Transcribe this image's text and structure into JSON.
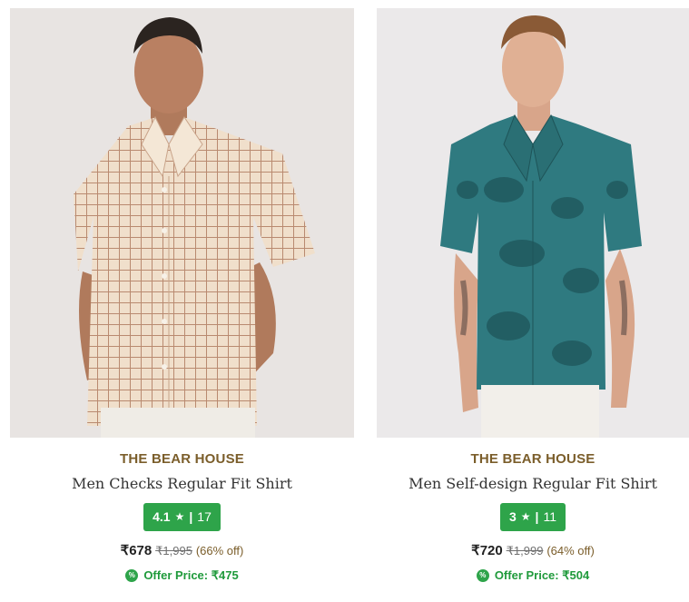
{
  "products": [
    {
      "brand": "THE BEAR HOUSE",
      "name": "Men Checks Regular Fit Shirt",
      "rating": "4.1",
      "rating_star": "★",
      "rating_sep": "|",
      "reviews": "17",
      "price": "₹678",
      "mrp": "₹1,995",
      "discount": "(66% off)",
      "offer_label": "Offer Price: ₹475",
      "offer_icon": "%",
      "shirt_color": "#efdcc8",
      "check_color": "#b9876b"
    },
    {
      "brand": "THE BEAR HOUSE",
      "name": "Men Self-design Regular Fit Shirt",
      "rating": "3",
      "rating_star": "★",
      "rating_sep": "|",
      "reviews": "11",
      "price": "₹720",
      "mrp": "₹1,999",
      "discount": "(64% off)",
      "offer_label": "Offer Price: ₹504",
      "offer_icon": "%",
      "shirt_color": "#2f7a80",
      "pattern_color": "#225e63"
    }
  ],
  "colors": {
    "brand_text": "#7b5e2b",
    "rating_bg": "#2ea44a",
    "offer_text": "#1f9a3b"
  }
}
